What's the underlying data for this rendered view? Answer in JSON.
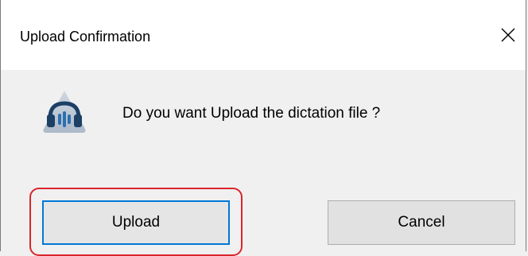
{
  "dialog": {
    "title": "Upload Confirmation",
    "message": "Do you want Upload the dictation file ?",
    "close_icon": "close-icon",
    "app_icon": "headphones-app-icon"
  },
  "buttons": {
    "upload_label": "Upload",
    "cancel_label": "Cancel"
  },
  "colors": {
    "focus_border": "#0078d7",
    "highlight_annotation": "#d9262c",
    "dialog_background": "#f0f0f0",
    "titlebar_background": "#ffffff"
  }
}
